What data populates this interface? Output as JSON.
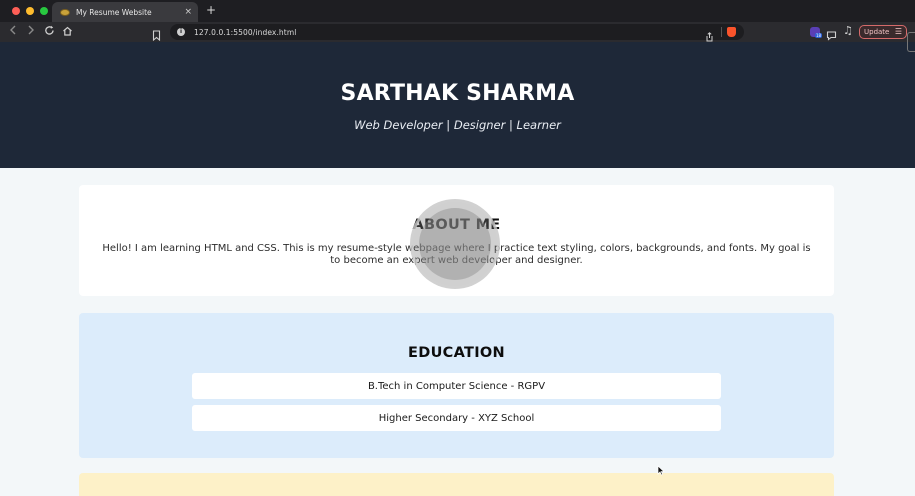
{
  "browser": {
    "tab": {
      "title": "My Resume Website",
      "close": "×"
    },
    "new_tab": "+",
    "url": "127.0.0.1:5500/index.html",
    "update_label": "Update",
    "extension_badge": "18"
  },
  "page": {
    "hero": {
      "name": "SARTHAK SHARMA",
      "tagline": "Web Developer | Designer | Learner"
    },
    "about": {
      "title": "ABOUT ME",
      "text": "Hello! I am learning HTML and CSS. This is my resume-style webpage where I practice text styling, colors, backgrounds, and fonts. My goal is to become an expert web developer and designer."
    },
    "education": {
      "title": "EDUCATION",
      "items": [
        "B.Tech in Computer Science - RGPV",
        "Higher Secondary - XYZ School"
      ]
    }
  },
  "colors": {
    "hero_bg": "#1e2838",
    "page_bg": "#f3f7f9",
    "education_bg": "#dcecfb",
    "next_section_bg": "#fdf1c8"
  },
  "icons": [
    "back-icon",
    "forward-icon",
    "reload-icon",
    "home-icon",
    "bookmark-icon",
    "site-info-icon",
    "share-icon",
    "brave-shield-icon",
    "extension-icon",
    "chat-icon",
    "media-icon",
    "menu-icon",
    "video-play-icon",
    "mouse-cursor-icon"
  ]
}
